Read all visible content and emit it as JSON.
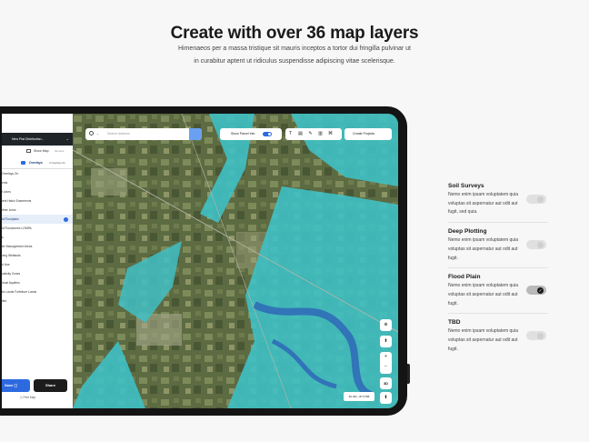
{
  "hero": {
    "title": "Create with over 36 map layers",
    "subtitle_line1": "Himenaeos per a massa tristique sit mauris inceptos a tortor dui fringilla pulvinar ut",
    "subtitle_line2": "in curabitur aptent ut ridiculus suspendisse adipiscing vitae scelerisque."
  },
  "app": {
    "project_title": "New Plat Distribution...",
    "show_map_label": "Show Map",
    "show_map_hint": "this acre",
    "overlays_tab": "Overlays",
    "overlays_hint": "4 Overlays On",
    "sidebar_items": [
      "Overlays On",
      "ents",
      "t Lines",
      "ient Hatch Easements",
      "rther Lines",
      "ld Floodplain",
      "ld Floodzones LOMRs",
      "s",
      "ter Management Areas",
      "ving Wetlands",
      "d Use",
      "ustivity Zones",
      "ctual Aquifers",
      "ks Lands Forfeiture Lands",
      "ltes"
    ],
    "selected_item": "ld Floodplain",
    "save_label": "Save",
    "share_label": "Share",
    "print_label": "Print Map",
    "search_placeholder": "Search Address",
    "parcel_toggle_label": "Show Parcel Info",
    "create_projects_label": "Create Projects",
    "coords": "30.331, -87.0798",
    "zoom_in": "+",
    "zoom_out": "−",
    "three_d": "3D"
  },
  "layers": [
    {
      "title": "Soil Surveys",
      "desc": "Nemo enim ipsam voluptatem quia voluptas sit aspernatur aut odit aut fugit, sed quia.",
      "on": false
    },
    {
      "title": "Deep Plotting",
      "desc": "Nemo enim ipsam voluptatem quia voluptas sit aspernatur aut odit aut fugit.",
      "on": false
    },
    {
      "title": "Flood Plain",
      "desc": "Nemo enim ipsam voluptatem quia voluptas sit aspernatur aut odit aut fugit.",
      "on": true
    },
    {
      "title": "TBD",
      "desc": "Nemo enim ipsam voluptatem quia voluptas sit aspernatur aut odit aut fugit.",
      "on": false
    }
  ],
  "colors": {
    "accent": "#2d6ae0",
    "flood": "#3fc0c4",
    "dark": "#141414"
  }
}
